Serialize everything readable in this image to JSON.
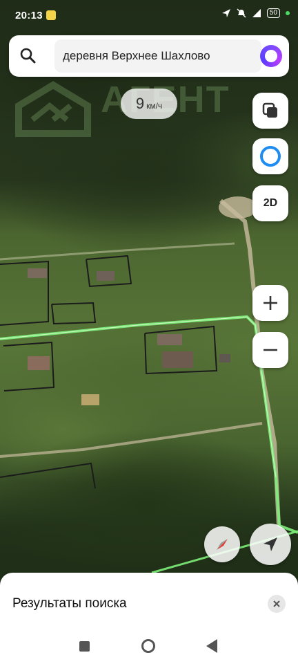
{
  "status_bar": {
    "time": "20:13",
    "battery": "50"
  },
  "search": {
    "query": "деревня Верхнее Шахлово"
  },
  "watermark": {
    "text": "АГЕНТ"
  },
  "speed": {
    "value": "9",
    "unit": "км/ч"
  },
  "map_controls": {
    "mode_label": "2D"
  },
  "bottom_sheet": {
    "title": "Результаты поиска"
  },
  "icons": {
    "search": "search-icon",
    "assistant": "alice-icon",
    "layers": "layers-icon",
    "zoom_in": "plus-icon",
    "zoom_out": "minus-icon",
    "compass": "compass-icon",
    "location": "navigation-arrow-icon",
    "close": "close-icon"
  },
  "colors": {
    "route": "#7ef07a",
    "assistant": "#7b4cff",
    "accent_blue": "#1e8cf0"
  }
}
